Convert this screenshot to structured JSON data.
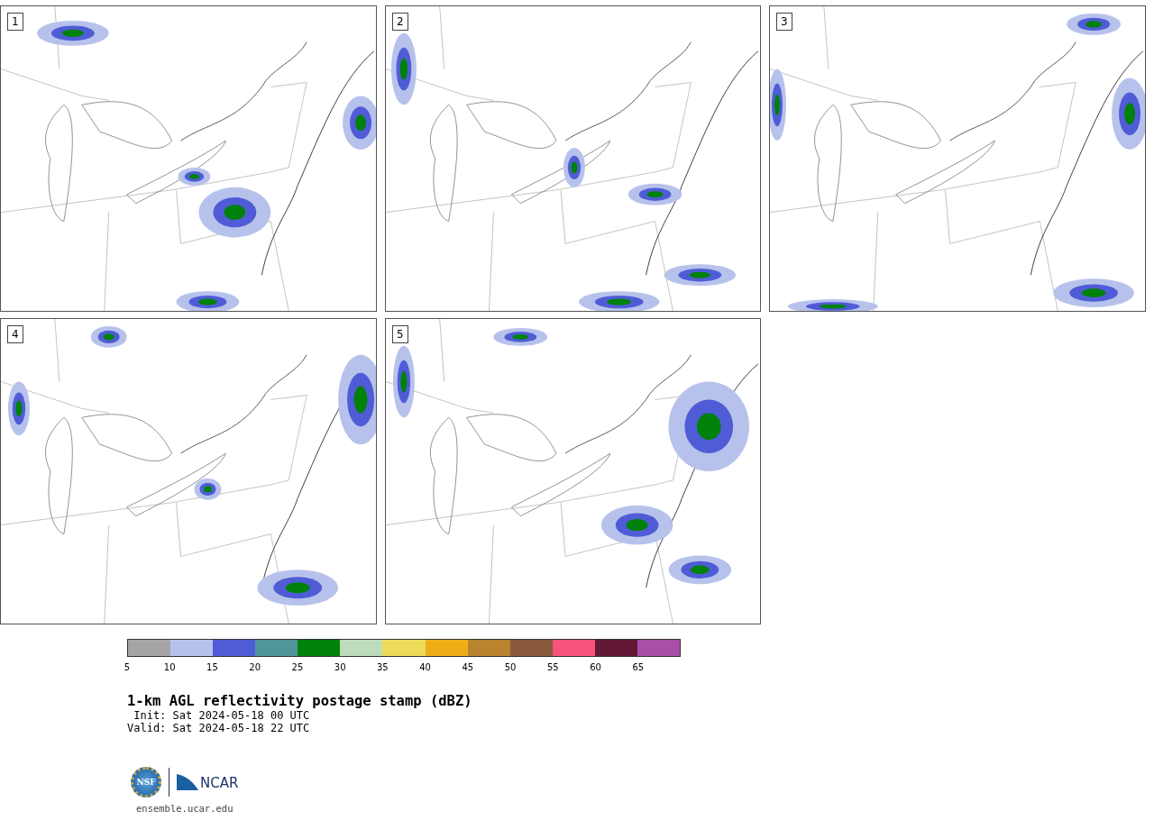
{
  "panels": [
    {
      "label": "1"
    },
    {
      "label": "2"
    },
    {
      "label": "3"
    },
    {
      "label": "4"
    },
    {
      "label": "5"
    }
  ],
  "colorbar": {
    "segments": [
      {
        "color": "#a5a5a5"
      },
      {
        "color": "#b7c2ec"
      },
      {
        "color": "#505cd6"
      },
      {
        "color": "#4f9599"
      },
      {
        "color": "#00820a"
      },
      {
        "color": "#bddcbb"
      },
      {
        "color": "#eedb5a"
      },
      {
        "color": "#efad17"
      },
      {
        "color": "#b9832f"
      },
      {
        "color": "#8a5a3d"
      },
      {
        "color": "#f5527c"
      },
      {
        "color": "#631835"
      },
      {
        "color": "#ab4ea8"
      }
    ],
    "ticks": [
      "5",
      "10",
      "15",
      "20",
      "25",
      "30",
      "35",
      "40",
      "45",
      "50",
      "55",
      "60",
      "65"
    ]
  },
  "title": "1-km AGL reflectivity postage stamp (dBZ)",
  "init": "Init: Sat 2024-05-18 00 UTC",
  "valid": "Valid: Sat 2024-05-18 22 UTC",
  "logos": {
    "nsf": "NSF",
    "ncar": "NCAR"
  },
  "url": "ensemble.ucar.edu"
}
